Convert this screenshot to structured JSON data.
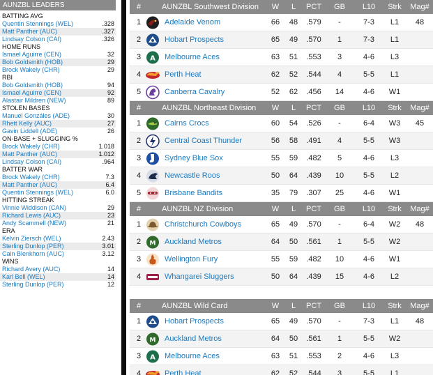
{
  "leaders": {
    "title": "AUNZBL LEADERS",
    "categories": [
      {
        "name": "BATTING AVG",
        "rows": [
          {
            "name": "Quentin Stennings (WEL)",
            "value": ".328"
          },
          {
            "name": "Matt Panther (AUC)",
            "value": ".327"
          },
          {
            "name": "Lindsay Colson (CAI)",
            "value": ".326"
          }
        ]
      },
      {
        "name": "HOME RUNS",
        "rows": [
          {
            "name": "Ismael Aguirre (CEN)",
            "value": "32"
          },
          {
            "name": "Bob Goldsmith (HOB)",
            "value": "29"
          },
          {
            "name": "Brock Wakely (CHR)",
            "value": "29"
          }
        ]
      },
      {
        "name": "RBI",
        "rows": [
          {
            "name": "Bob Goldsmith (HOB)",
            "value": "94"
          },
          {
            "name": "Ismael Aguirre (CEN)",
            "value": "92"
          },
          {
            "name": "Alastair Mildren (NEW)",
            "value": "89"
          }
        ]
      },
      {
        "name": "STOLEN BASES",
        "rows": [
          {
            "name": "Manuel Gonzáles (ADE)",
            "value": "30"
          },
          {
            "name": "Rhett Kelly (AUC)",
            "value": "27"
          },
          {
            "name": "Gavin Liddell (ADE)",
            "value": "26"
          }
        ]
      },
      {
        "name": "ON-BASE + SLUGGING %",
        "rows": [
          {
            "name": "Brock Wakely (CHR)",
            "value": "1.018"
          },
          {
            "name": "Matt Panther (AUC)",
            "value": "1.012"
          },
          {
            "name": "Lindsay Colson (CAI)",
            "value": ".964"
          }
        ]
      },
      {
        "name": "BATTER WAR",
        "rows": [
          {
            "name": "Brock Wakely (CHR)",
            "value": "7.3"
          },
          {
            "name": "Matt Panther (AUC)",
            "value": "6.4"
          },
          {
            "name": "Quentin Stennings (WEL)",
            "value": "6.0"
          }
        ]
      },
      {
        "name": "HITTING STREAK",
        "rows": [
          {
            "name": "Vinnie Widdison (CAN)",
            "value": "29"
          },
          {
            "name": "Richard Lewis (AUC)",
            "value": "23"
          },
          {
            "name": "Andy Scammell (NEW)",
            "value": "21"
          }
        ]
      },
      {
        "name": "ERA",
        "rows": [
          {
            "name": "Kelvin Ziersch (WEL)",
            "value": "2.43"
          },
          {
            "name": "Sterling Dunlop (PER)",
            "value": "3.01"
          },
          {
            "name": "Cain Blenkhorn (AUC)",
            "value": "3.12"
          }
        ]
      },
      {
        "name": "WINS",
        "rows": [
          {
            "name": "Richard Avery (AUC)",
            "value": "14"
          },
          {
            "name": "Karl Bell (WEL)",
            "value": "14"
          },
          {
            "name": "Sterling Dunlop (PER)",
            "value": "12"
          }
        ]
      }
    ]
  },
  "columns": {
    "num": "#",
    "w": "W",
    "l": "L",
    "pct": "PCT",
    "gb": "GB",
    "l10": "L10",
    "strk": "Strk",
    "mag": "Mag#"
  },
  "divisions": [
    {
      "title": "AUNZBL Southwest Division",
      "teams": [
        {
          "rank": "1",
          "name": "Adelaide Venom",
          "w": "66",
          "l": "48",
          "pct": ".579",
          "gb": "-",
          "l10": "7-3",
          "strk": "L1",
          "mag": "48",
          "logo": "venom",
          "color": "#8b1c1c"
        },
        {
          "rank": "2",
          "name": "Hobart Prospects",
          "w": "65",
          "l": "49",
          "pct": ".570",
          "gb": "1",
          "l10": "7-3",
          "strk": "L1",
          "mag": "",
          "logo": "prospects",
          "color": "#1f4d8c"
        },
        {
          "rank": "3",
          "name": "Melbourne Aces",
          "w": "63",
          "l": "51",
          "pct": ".553",
          "gb": "3",
          "l10": "4-6",
          "strk": "L3",
          "mag": "",
          "logo": "aces",
          "color": "#1d6f4b"
        },
        {
          "rank": "4",
          "name": "Perth Heat",
          "w": "62",
          "l": "52",
          "pct": ".544",
          "gb": "4",
          "l10": "5-5",
          "strk": "L1",
          "mag": "",
          "logo": "heat",
          "color": "#c4262e"
        },
        {
          "rank": "5",
          "name": "Canberra Cavalry",
          "w": "52",
          "l": "62",
          "pct": ".456",
          "gb": "14",
          "l10": "4-6",
          "strk": "W1",
          "mag": "",
          "logo": "cavalry",
          "color": "#6b3fa0"
        }
      ]
    },
    {
      "title": "AUNZBL Northeast Division",
      "teams": [
        {
          "rank": "1",
          "name": "Cairns Crocs",
          "w": "60",
          "l": "54",
          "pct": ".526",
          "gb": "-",
          "l10": "6-4",
          "strk": "W3",
          "mag": "45",
          "logo": "crocs",
          "color": "#2e6b2a"
        },
        {
          "rank": "2",
          "name": "Central Coast Thunder",
          "w": "56",
          "l": "58",
          "pct": ".491",
          "gb": "4",
          "l10": "5-5",
          "strk": "W3",
          "mag": "",
          "logo": "thunder",
          "color": "#1a2f6b"
        },
        {
          "rank": "3",
          "name": "Sydney Blue Sox",
          "w": "55",
          "l": "59",
          "pct": ".482",
          "gb": "5",
          "l10": "4-6",
          "strk": "L3",
          "mag": "",
          "logo": "bluesox",
          "color": "#1c4fa3"
        },
        {
          "rank": "4",
          "name": "Newcastle Roos",
          "w": "50",
          "l": "64",
          "pct": ".439",
          "gb": "10",
          "l10": "5-5",
          "strk": "L2",
          "mag": "",
          "logo": "roos",
          "color": "#1c2b4a"
        },
        {
          "rank": "5",
          "name": "Brisbane Bandits",
          "w": "35",
          "l": "79",
          "pct": ".307",
          "gb": "25",
          "l10": "4-6",
          "strk": "W1",
          "mag": "",
          "logo": "bandits",
          "color": "#a0232e"
        }
      ]
    },
    {
      "title": "AUNZBL NZ Division",
      "teams": [
        {
          "rank": "1",
          "name": "Christchurch Cowboys",
          "w": "65",
          "l": "49",
          "pct": ".570",
          "gb": "-",
          "l10": "6-4",
          "strk": "W2",
          "mag": "48",
          "logo": "cowboys",
          "color": "#7a5a2e"
        },
        {
          "rank": "2",
          "name": "Auckland Metros",
          "w": "64",
          "l": "50",
          "pct": ".561",
          "gb": "1",
          "l10": "5-5",
          "strk": "W2",
          "mag": "",
          "logo": "metros",
          "color": "#2f6a2c"
        },
        {
          "rank": "3",
          "name": "Wellington Fury",
          "w": "55",
          "l": "59",
          "pct": ".482",
          "gb": "10",
          "l10": "4-6",
          "strk": "W1",
          "mag": "",
          "logo": "fury",
          "color": "#c9581c"
        },
        {
          "rank": "4",
          "name": "Whangarei Sluggers",
          "w": "50",
          "l": "64",
          "pct": ".439",
          "gb": "15",
          "l10": "4-6",
          "strk": "L2",
          "mag": "",
          "logo": "sluggers",
          "color": "#9b1f4a"
        }
      ]
    },
    {
      "title": "AUNZBL  Wild Card",
      "teams": [
        {
          "rank": "1",
          "name": "Hobart Prospects",
          "w": "65",
          "l": "49",
          "pct": ".570",
          "gb": "-",
          "l10": "7-3",
          "strk": "L1",
          "mag": "48",
          "logo": "prospects",
          "color": "#1f4d8c"
        },
        {
          "rank": "2",
          "name": "Auckland Metros",
          "w": "64",
          "l": "50",
          "pct": ".561",
          "gb": "1",
          "l10": "5-5",
          "strk": "W2",
          "mag": "",
          "logo": "metros",
          "color": "#2f6a2c"
        },
        {
          "rank": "3",
          "name": "Melbourne Aces",
          "w": "63",
          "l": "51",
          "pct": ".553",
          "gb": "2",
          "l10": "4-6",
          "strk": "L3",
          "mag": "",
          "logo": "aces",
          "color": "#1d6f4b"
        },
        {
          "rank": "4",
          "name": "Perth Heat",
          "w": "62",
          "l": "52",
          "pct": ".544",
          "gb": "3",
          "l10": "5-5",
          "strk": "L1",
          "mag": "",
          "logo": "heat",
          "color": "#c4262e"
        }
      ]
    }
  ]
}
